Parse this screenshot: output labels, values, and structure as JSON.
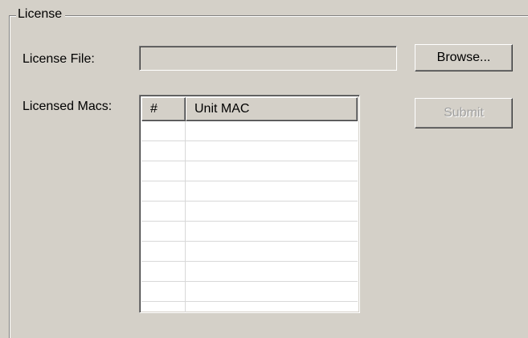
{
  "license_group": {
    "title": "License",
    "license_file": {
      "label": "License File:",
      "value": "",
      "placeholder": ""
    },
    "browse_label": "Browse...",
    "licensed_macs": {
      "label": "Licensed Macs:",
      "columns": [
        "#",
        "Unit MAC"
      ],
      "rows": [
        [
          "",
          ""
        ],
        [
          "",
          ""
        ],
        [
          "",
          ""
        ],
        [
          "",
          ""
        ],
        [
          "",
          ""
        ],
        [
          "",
          ""
        ],
        [
          "",
          ""
        ],
        [
          "",
          ""
        ],
        [
          "",
          ""
        ],
        [
          "",
          ""
        ]
      ]
    },
    "submit_label": "Submit",
    "submit_enabled": false
  }
}
